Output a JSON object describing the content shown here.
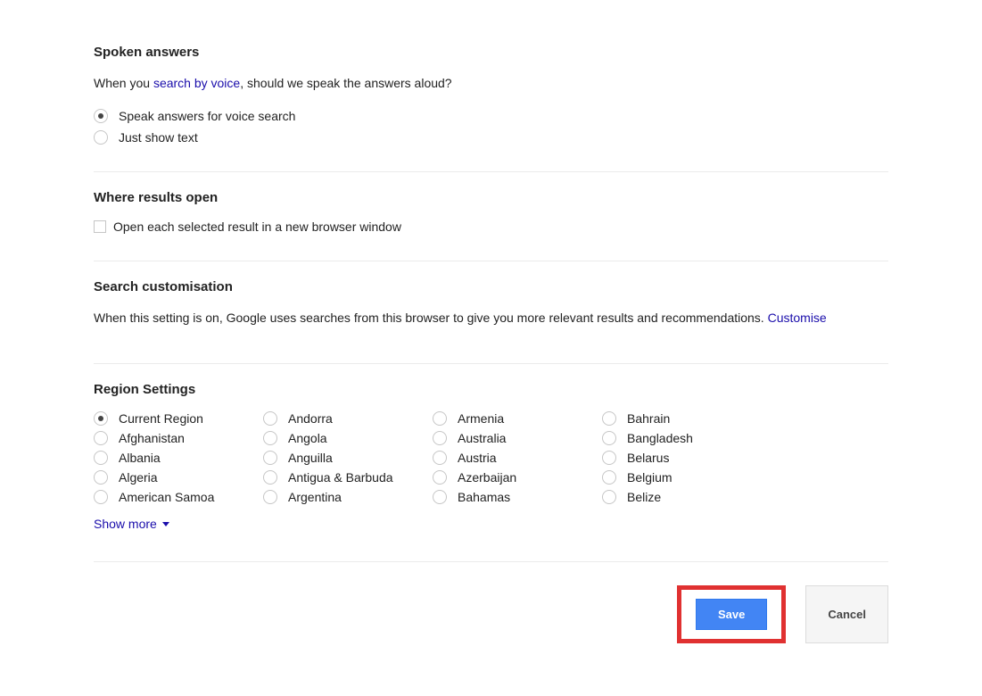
{
  "spoken": {
    "title": "Spoken answers",
    "desc_pre": "When you ",
    "desc_link": "search by voice",
    "desc_post": ", should we speak the answers aloud?",
    "option1": "Speak answers for voice search",
    "option2": "Just show text"
  },
  "where": {
    "title": "Where results open",
    "checkbox_label": "Open each selected result in a new browser window"
  },
  "customisation": {
    "title": "Search customisation",
    "desc_pre": "When this setting is on, Google uses searches from this browser to give you more relevant results and recommendations. ",
    "link": "Customise"
  },
  "region": {
    "title": "Region Settings",
    "show_more": "Show more",
    "columns": [
      [
        "Current Region",
        "Afghanistan",
        "Albania",
        "Algeria",
        "American Samoa"
      ],
      [
        "Andorra",
        "Angola",
        "Anguilla",
        "Antigua & Barbuda",
        "Argentina"
      ],
      [
        "Armenia",
        "Australia",
        "Austria",
        "Azerbaijan",
        "Bahamas"
      ],
      [
        "Bahrain",
        "Bangladesh",
        "Belarus",
        "Belgium",
        "Belize"
      ]
    ],
    "selected": "Current Region"
  },
  "buttons": {
    "save": "Save",
    "cancel": "Cancel"
  }
}
